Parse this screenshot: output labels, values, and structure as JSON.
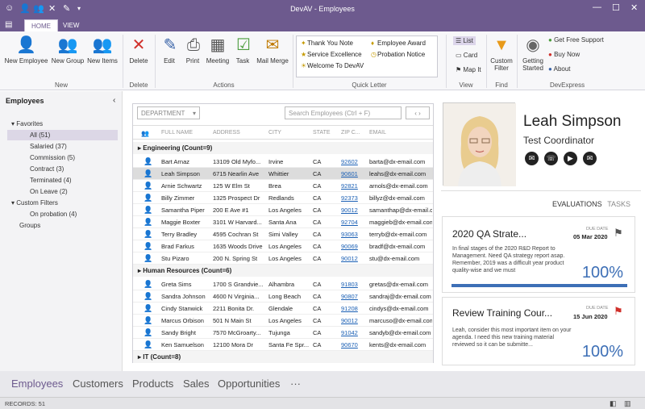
{
  "window": {
    "title": "DevAV - Employees"
  },
  "tabs": {
    "home": "HOME",
    "view": "VIEW"
  },
  "ribbon": {
    "new_employee": "New Employee",
    "new_group": "New Group",
    "new_items": "New Items",
    "delete": "Delete",
    "edit": "Edit",
    "print": "Print",
    "meeting": "Meeting",
    "task": "Task",
    "mail_merge": "Mail Merge",
    "quick_letter": [
      "Thank You Note",
      "Employee Award",
      "Service Excellence",
      "Probation Notice",
      "Welcome To DevAV"
    ],
    "list": "List",
    "card": "Card",
    "map_it": "Map It",
    "custom_filter": "Custom Filter",
    "getting_started": "Getting Started",
    "get_free_support": "Get Free Support",
    "buy_now": "Buy Now",
    "about": "About",
    "groups": {
      "new": "New",
      "delete": "Delete",
      "actions": "Actions",
      "quick_letter": "Quick Letter",
      "view": "View",
      "find": "Find",
      "devexpress": "DevExpress"
    }
  },
  "nav": {
    "header": "Employees",
    "collapse": "‹",
    "favorites": "Favorites",
    "all": "All (51)",
    "salaried": "Salaried (37)",
    "commission": "Commission (5)",
    "contract": "Contract (3)",
    "terminated": "Terminated (4)",
    "on_leave": "On Leave (2)",
    "custom_filters": "Custom Filters",
    "on_probation": "On probation  (4)",
    "groups": "Groups"
  },
  "grid": {
    "department": "DEPARTMENT",
    "search_placeholder": "Search Employees (Ctrl + F)",
    "nav_arrows": "‹ ›",
    "columns": [
      "FULL NAME",
      "ADDRESS",
      "CITY",
      "STATE",
      "ZIP C...",
      "EMAIL"
    ],
    "groups": [
      {
        "title": "Engineering (Count=9)",
        "rows": [
          [
            "Bart Arnaz",
            "13109 Old Myfo...",
            "Irvine",
            "CA",
            "92602",
            "barta@dx-email.com"
          ],
          [
            "Leah Simpson",
            "6715 Nearlin Ave",
            "Whittier",
            "CA",
            "90601",
            "leahs@dx-email.com"
          ],
          [
            "Arnie Schwartz",
            "125 W Elm St",
            "Brea",
            "CA",
            "92821",
            "arnols@dx-email.com"
          ],
          [
            "Billy Zimmer",
            "1325 Prospect Dr",
            "Redlands",
            "CA",
            "92373",
            "billyz@dx-email.com"
          ],
          [
            "Samantha Piper",
            "200 E Ave #1",
            "Los Angeles",
            "CA",
            "90012",
            "samanthap@dx-email.com"
          ],
          [
            "Maggie Boxter",
            "3101 W Harvard...",
            "Santa Ana",
            "CA",
            "92704",
            "maggieb@dx-email.com"
          ],
          [
            "Terry Bradley",
            "4595 Cochran St",
            "Simi Valley",
            "CA",
            "93063",
            "terryb@dx-email.com"
          ],
          [
            "Brad Farkus",
            "1635 Woods Drive",
            "Los Angeles",
            "CA",
            "90069",
            "bradf@dx-email.com"
          ],
          [
            "Stu Pizaro",
            "200 N. Spring St",
            "Los Angeles",
            "CA",
            "90012",
            "stu@dx-email.com"
          ]
        ]
      },
      {
        "title": "Human Resources (Count=6)",
        "rows": [
          [
            "Greta Sims",
            "1700 S Grandvie...",
            "Alhambra",
            "CA",
            "91803",
            "gretas@dx-email.com"
          ],
          [
            "Sandra Johnson",
            "4600 N Virginia...",
            "Long Beach",
            "CA",
            "90807",
            "sandraj@dx-email.com"
          ],
          [
            "Cindy Stanwick",
            "2211 Bonita Dr.",
            "Glendale",
            "CA",
            "91208",
            "cindys@dx-email.com"
          ],
          [
            "Marcus Orbison",
            "501 N Main St",
            "Los Angeles",
            "CA",
            "90012",
            "marcuso@dx-email.com"
          ],
          [
            "Sandy Bright",
            "7570 McGroarty...",
            "Tujunga",
            "CA",
            "91042",
            "sandyb@dx-email.com"
          ],
          [
            "Ken Samuelson",
            "12100 Mora Dr",
            "Santa Fe Spr...",
            "CA",
            "90670",
            "kents@dx-email.com"
          ]
        ]
      },
      {
        "title": "IT (Count=8)",
        "rows": []
      }
    ]
  },
  "detail": {
    "name": "Leah Simpson",
    "role": "Test Coordinator",
    "evaluations": "EVALUATIONS",
    "tasks": "TASKS",
    "cards": [
      {
        "title": "2020 QA Strate...",
        "body": "In final stages of the 2020 R&D Report to Management. Need QA strategy report asap. Remember, 2019 was a difficult year product quality-wise and we must",
        "due_label": "DUE DATE",
        "due_date": "05 Mar 2020",
        "percent": "100%",
        "progress": 1.0
      },
      {
        "title": "Review Training Cour...",
        "body": "Leah, consider this most important item on your agenda. I need this new training material reviewed so it can be submitte...",
        "due_label": "DUE DATE",
        "due_date": "15 Jun 2020",
        "percent": "100%",
        "progress": 1.0
      }
    ]
  },
  "bottom_nav": [
    "Employees",
    "Customers",
    "Products",
    "Sales",
    "Opportunities",
    "···"
  ],
  "status": {
    "records": "RECORDS: 51"
  },
  "colors": {
    "accent": "#6d5a8e",
    "link": "#1a5fb4",
    "progress": "#3d6fb6"
  }
}
